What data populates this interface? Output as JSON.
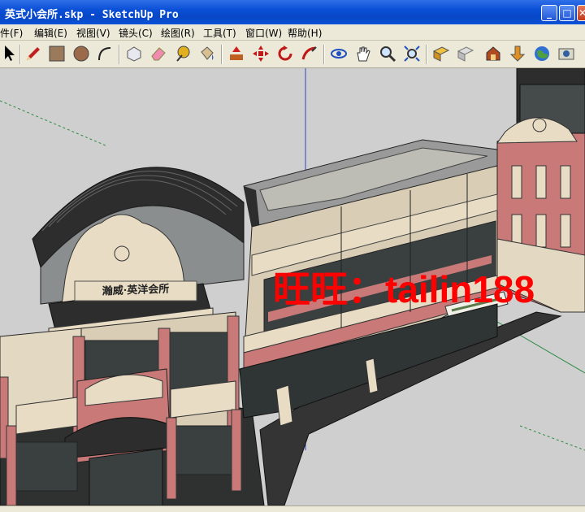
{
  "window": {
    "title": "英式小会所.skp - SketchUp Pro",
    "controls": {
      "minimize": "_",
      "maximize": "□",
      "close": "✕"
    }
  },
  "menu": [
    {
      "label": "文件(F)"
    },
    {
      "label": "编辑(E)"
    },
    {
      "label": "视图(V)"
    },
    {
      "label": "镜头(C)"
    },
    {
      "label": "绘图(R)"
    },
    {
      "label": "工具(T)"
    },
    {
      "label": "窗口(W)"
    },
    {
      "label": "帮助(H)"
    }
  ],
  "toolbar": {
    "tools": [
      "select-arrow-icon",
      "pencil-icon",
      "rectangle-icon",
      "circle-icon",
      "arc-icon",
      "make-component-icon",
      "eraser-icon",
      "tape-measure-icon",
      "paint-bucket-icon",
      "push-pull-icon",
      "move-icon",
      "rotate-icon",
      "follow-me-icon",
      "orbit-icon",
      "pan-hand-icon",
      "zoom-icon",
      "zoom-extents-icon",
      "get-models-icon",
      "share-model-icon",
      "warehouse-icon",
      "send-to-layout-icon",
      "google-earth-icon"
    ]
  },
  "scene": {
    "watermark": "旺旺：tailin188",
    "signboard": "瀚威·英洋会所",
    "colors": {
      "background": "#cfcfcf",
      "brick": "#c97a78",
      "trim": "#e8dcc4",
      "roof": "#2d2d2d",
      "glass": "#3a4040",
      "awning_stripe": "#5a7a4a",
      "blue_axis": "#3040c0",
      "green_axis": "#2a8a40"
    }
  }
}
